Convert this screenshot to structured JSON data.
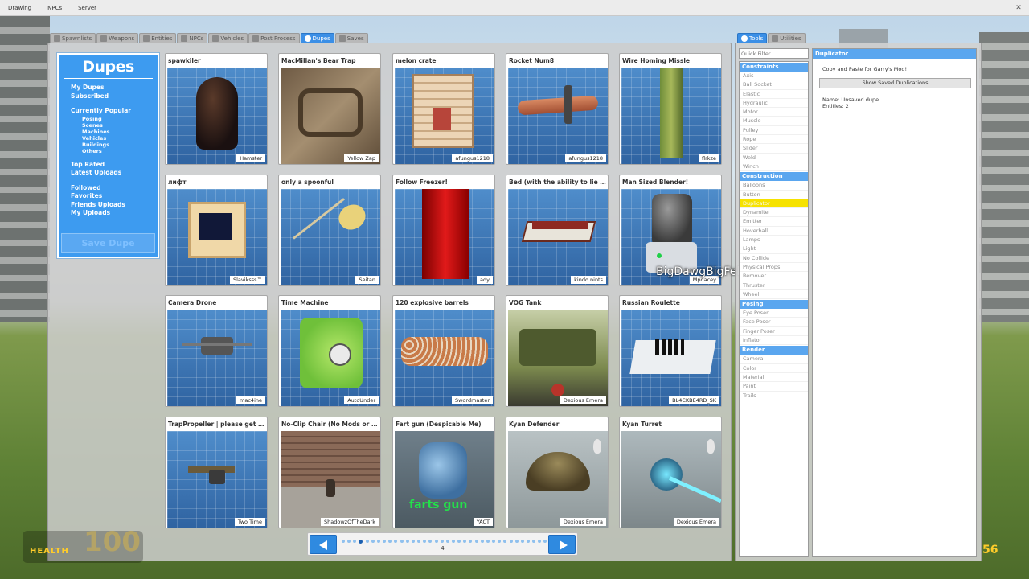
{
  "menubar": {
    "items": [
      "Drawing",
      "NPCs",
      "Server"
    ]
  },
  "spawnmenu": {
    "tabs": [
      {
        "label": "Spawnlists",
        "active": false
      },
      {
        "label": "Weapons",
        "active": false
      },
      {
        "label": "Entities",
        "active": false
      },
      {
        "label": "NPCs",
        "active": false
      },
      {
        "label": "Vehicles",
        "active": false
      },
      {
        "label": "Post Process",
        "active": false
      },
      {
        "label": "Dupes",
        "active": true
      },
      {
        "label": "Saves",
        "active": false
      }
    ]
  },
  "nav": {
    "title": "Dupes",
    "my_dupes": "My Dupes",
    "subscribed": "Subscribed",
    "currently_popular": "Currently Popular",
    "posing": "Posing",
    "scenes": "Scenes",
    "machines": "Machines",
    "vehicles": "Vehicles",
    "buildings": "Buildings",
    "others": "Others",
    "top_rated": "Top Rated",
    "latest_uploads": "Latest Uploads",
    "followed": "Followed",
    "favorites": "Favorites",
    "friends_uploads": "Friends Uploads",
    "my_uploads": "My Uploads",
    "save_dupe": "Save Dupe"
  },
  "dupes": [
    {
      "title": "spawkiler",
      "author": "Hamster",
      "icon": "dome-object"
    },
    {
      "title": "MacMillan's Bear Trap",
      "author": "Yellow Zap",
      "icon": "ground-trap"
    },
    {
      "title": "melon crate",
      "author": "afungus1218",
      "icon": "wooden-crate"
    },
    {
      "title": "Rocket Num8",
      "author": "afungus1218",
      "icon": "rocket"
    },
    {
      "title": "Wire Homing Missle",
      "author": "flrkze",
      "icon": "missile-pillar"
    },
    {
      "title": "лифт",
      "author": "Slaviksss™",
      "icon": "wooden-lift"
    },
    {
      "title": "only a spoonful",
      "author": "Seitan",
      "icon": "spoon"
    },
    {
      "title": "Follow Freezer!",
      "author": "ady",
      "icon": "red-freezer"
    },
    {
      "title": "Bed (with the ability to lie down)",
      "author": "kindo nints",
      "icon": "bed"
    },
    {
      "title": "Man Sized Blender!",
      "author": "Mpdacey",
      "icon": "blender"
    },
    {
      "title": "Camera Drone",
      "author": "mac4ine",
      "icon": "drone"
    },
    {
      "title": "Time Machine",
      "author": "AutoUnder",
      "icon": "green-cube-clock"
    },
    {
      "title": "120 explosive barrels",
      "author": "Swordmaster",
      "icon": "barrel-cluster"
    },
    {
      "title": "VOG Tank",
      "author": "Dexious Emera",
      "icon": "tank"
    },
    {
      "title": "Russian Roulette",
      "author": "BL4CKBE4RD_SK",
      "icon": "roulette-table"
    },
    {
      "title": "TrapPropeller | please get thi...",
      "author": "Two Time",
      "icon": "propeller"
    },
    {
      "title": "No-Clip Chair (No Mods or Th...",
      "author": "ShadowzOfTheDark",
      "icon": "brick-wall-chair"
    },
    {
      "title": "Fart gun (Despicable Me)",
      "author": "YACT",
      "icon": "fart-gun",
      "overlay_text": "farts gun"
    },
    {
      "title": "Kyan Defender",
      "author": "Dexious Emera",
      "icon": "ufo-dome"
    },
    {
      "title": "Kyan Turret",
      "author": "Dexious Emera",
      "icon": "turret"
    }
  ],
  "pager": {
    "page": "4",
    "total_dots": 36,
    "current_index": 3
  },
  "overlay_player_name": "BigDawgBigFella W",
  "toolpanel": {
    "tabs": [
      {
        "label": "Tools",
        "active": true
      },
      {
        "label": "Utilities",
        "active": false
      }
    ],
    "filter_placeholder": "Quick Filter...",
    "categories": [
      {
        "name": "Constraints",
        "items": [
          "Axis",
          "Ball Socket",
          "Elastic",
          "Hydraulic",
          "Motor",
          "Muscle",
          "Pulley",
          "Rope",
          "Slider",
          "Weld",
          "Winch"
        ]
      },
      {
        "name": "Construction",
        "items": [
          "Balloons",
          "Button",
          "Duplicator",
          "Dynamite",
          "Emitter",
          "Hoverball",
          "Lamps",
          "Light",
          "No Collide",
          "Physical Props",
          "Remover",
          "Thruster",
          "Wheel"
        ]
      },
      {
        "name": "Posing",
        "items": [
          "Eye Poser",
          "Face Poser",
          "Finger Poser",
          "Inflator"
        ]
      },
      {
        "name": "Render",
        "items": [
          "Camera",
          "Color",
          "Material",
          "Paint",
          "Trails"
        ]
      }
    ],
    "selected_tool": "Duplicator",
    "panel": {
      "header": "Duplicator",
      "description": "Copy and Paste for Garry's Mod!",
      "button": "Show Saved Duplications",
      "name_line": "Name: Unsaved dupe",
      "entities_line": "Entities: 2"
    }
  },
  "hud": {
    "health_label": "HEALTH",
    "health_value": "100",
    "ammo": "56"
  },
  "colors": {
    "accent": "#3d9bf0",
    "selected_tool": "#f6e200",
    "hud": "#ffcc2a"
  }
}
